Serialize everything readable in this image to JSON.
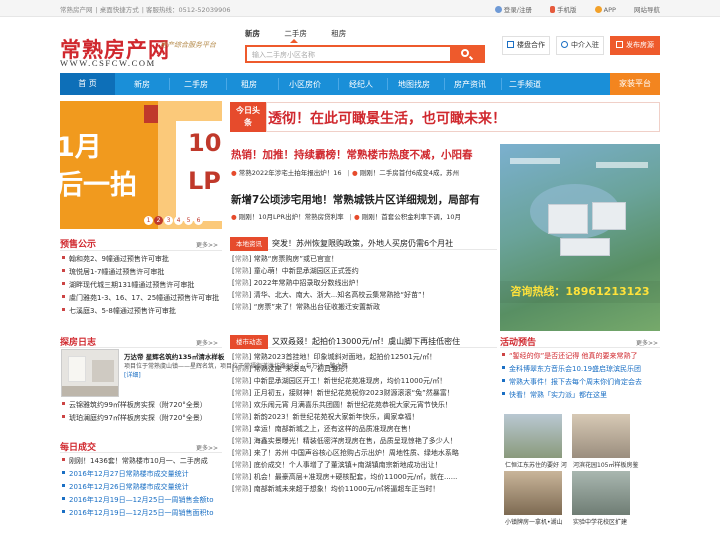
{
  "topbar": {
    "site": "常熟房产网",
    "desktop": "桌面快捷方式",
    "hotline": "客服热线：0512-52039906",
    "login": "登录/注册",
    "mobile": "手机版",
    "app": "APP",
    "sitemap": "网站导航"
  },
  "header": {
    "logo": "常熟房产网",
    "logo_url": "WWW.CSFCW.COM",
    "slogan": "房产综合服务平台",
    "search_tabs": [
      "新房",
      "二手房",
      "租房"
    ],
    "search_placeholder": "输入二手房小区名称",
    "btn_cooperate": "楼盘合作",
    "btn_agent": "中介入驻",
    "btn_post": "发布房源"
  },
  "nav": [
    "首 页",
    "新房",
    "二手房",
    "租房",
    "小区房价",
    "经纪人",
    "地图找房",
    "房产资讯",
    "二手频道",
    "家装平台"
  ],
  "slideshow": {
    "line1": "1月",
    "line2": "后一拍",
    "right_text": "10",
    "right_text2": "LP",
    "dots": [
      "1",
      "2",
      "3",
      "4",
      "5",
      "6"
    ],
    "active_dot": 1
  },
  "presale": {
    "title": "预售公示",
    "more": "更多>>",
    "items": [
      "翰和苑2、9幢通过预售许可审批",
      "琉悦居1-7幢通过预售许可审批",
      "湖畔现代城三期131幢通过预售许可审批",
      "虞门雅苑1-3、16、17、25幢通过预售许可审批",
      "七溪庭3、5-8幢通过预售许可审批"
    ]
  },
  "diary": {
    "title": "探房日志",
    "more": "更多>>",
    "feature_title": "万达帝 星辉名筑约135㎡清水样板",
    "feature_body": "项目位于常熟虞山镇——星辉名筑，项目位于常福街道潍坊路88号，与万达一路之隔",
    "feature_link": "[详细]",
    "items": [
      "云锦雅筑约99㎡样板房实探（附720°全景）",
      "琥珀澜庭约97㎡样板房实探（附720°全景）"
    ]
  },
  "daily": {
    "title": "每日成交",
    "more": "更多>>",
    "items": [
      "刚刚！1436套！常熟楼市10月一、二手房成",
      "2016年12月27日常熟楼市成交量统计",
      "2016年12月26日常熟楼市成交量统计",
      "2016年12月19日—12月25日一周销售金额to",
      "2016年12月19日—12月25日一周销售面积to"
    ]
  },
  "center": {
    "today_label": "今日头条",
    "headline1": "透彻！在此可瞰景生活，也可瞰未来！",
    "headline2": "热销！加推！持续霸榜！常熟楼市热度不减，小阳春",
    "headline2_sub1": "常熟2022年涉宅土拍年报出炉！16",
    "headline2_sub2": "刚刚！二手房首付6成变4成，苏州",
    "headline3": "新增7公顷涉宅用地！常熟城铁片区详细规划，局部有",
    "headline3_sub1": "刚刚！10月LPR出炉！常熟房贷利率",
    "headline3_sub2": "刚刚！首套公积金利率下调，10月",
    "local_tag": "本地资讯",
    "local_headline": "突发！苏州恢复限购政策，外地人买房仍需6个月社",
    "local_items": [
      [
        "常熟",
        "常熟“房票购房”或已官宣！"
      ],
      [
        "常熟",
        "童心萌！中新昆承湖园区正式签约"
      ],
      [
        "常熟",
        "2022年常熟中招录取分数线出炉！"
      ],
      [
        "常熟",
        "清华、北大、南大、浙大...知名高校云集常熟抢“好苗”！"
      ],
      [
        "常熟",
        "“房票”来了！常熟出台征收搬迁安置新政"
      ]
    ],
    "building_tag": "楼市动态",
    "building_headline": "又双叒叕！起拍价13000元/㎡！虞山脚下再挂低密住",
    "building_items": [
      [
        "常熟",
        "常熟2023首挂地！印象城斜对面地，起拍价12501元/㎡！"
      ],
      [
        "常熟",
        "常熟这座“未来岛”，初具雏形！"
      ],
      [
        "常熟",
        "中新昆承湖园区开工！新世纪花苑准现房，均价11000元/㎡！"
      ],
      [
        "常熟",
        "正月初五，接财神！新世纪花苑祝你2023财源滚滚“兔”然暴富！"
      ],
      [
        "常熟",
        "欢乐闹元宵 月满喜乐共团圆！新世纪花苑恭祝大家元宵节快乐！"
      ],
      [
        "常熟",
        "新韵2023！新世纪花苑祝大家新年快乐，阖家幸福！"
      ],
      [
        "常熟",
        "幸运！南部新城之上，还有这样的品质准现房在售！"
      ],
      [
        "常熟",
        "海鑫实景曝光！精装低密洋房现房在售，品质呈现惊艳了多少人！"
      ],
      [
        "常熟",
        "来了！苏州 中国声谷核心区抢购占示出炉！周地性质、绿地水系略"
      ],
      [
        "常熟",
        "底价成交！个人事增了了董滨镇+南湖镇南宗新地成功出让！"
      ],
      [
        "常熟",
        "机会！最豪高层+准现房+硬核配套，均价11000元/㎡，就在......"
      ],
      [
        "常熟",
        "南部新城未来超于想象！均价11000元/㎡将逼超车正当时！"
      ]
    ]
  },
  "right": {
    "map_phone": "咨询热线：18961213123",
    "event_title": "活动预告",
    "event_more": "更多>>",
    "events": [
      "“錾经的你”是否还记得 他真的要来常熟了",
      "金科博翠东方音乐会10.19盛启琼滨民乐团",
      "常熟大事件！报下去每个周末你们肯定会去",
      "快看！常熟「实力派」都在这里"
    ],
    "photos": [
      "仁恒江东苏住的要好  河",
      "河滨花园105㎡样板房鉴",
      "小镇牌房一拿机•湖山",
      "实验中学花校区扩建"
    ]
  },
  "colors": {
    "brand_red": "#d0282e",
    "nav_blue": "#1a8fd8",
    "accent_orange": "#ee5a2c"
  }
}
